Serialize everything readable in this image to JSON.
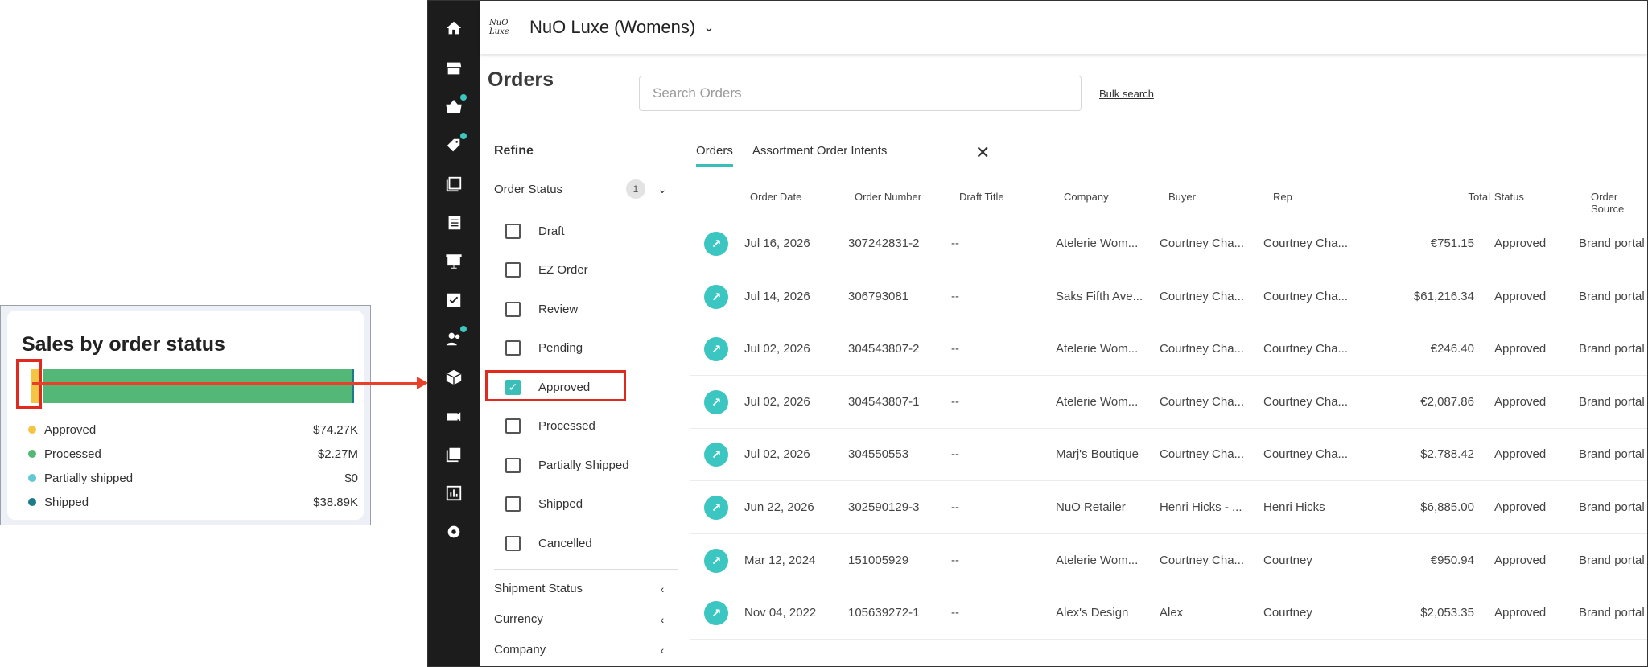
{
  "card": {
    "title": "Sales by order status",
    "legend": [
      {
        "label": "Approved",
        "value": "$74.27K",
        "color": "#f4c542"
      },
      {
        "label": "Processed",
        "value": "$2.27M",
        "color": "#52b777"
      },
      {
        "label": "Partially shipped",
        "value": "$0",
        "color": "#63c7d6"
      },
      {
        "label": "Shipped",
        "value": "$38.89K",
        "color": "#1b7a8c"
      }
    ]
  },
  "chart_data": {
    "type": "bar",
    "title": "Sales by order status",
    "categories": [
      "Approved",
      "Processed",
      "Partially shipped",
      "Shipped"
    ],
    "values": [
      74270,
      2270000,
      0,
      38890
    ],
    "orientation": "horizontal-stacked"
  },
  "header": {
    "brand_logo": "NuO Luxe",
    "brand_name": "NuO Luxe (Womens)"
  },
  "page": {
    "title": "Orders",
    "search_placeholder": "Search Orders",
    "bulk_search": "Bulk search"
  },
  "refine": {
    "title": "Refine",
    "order_status": {
      "label": "Order Status",
      "count": "1",
      "options": [
        {
          "label": "Draft",
          "checked": false
        },
        {
          "label": "EZ Order",
          "checked": false
        },
        {
          "label": "Review",
          "checked": false
        },
        {
          "label": "Pending",
          "checked": false
        },
        {
          "label": "Approved",
          "checked": true
        },
        {
          "label": "Processed",
          "checked": false
        },
        {
          "label": "Partially Shipped",
          "checked": false
        },
        {
          "label": "Shipped",
          "checked": false
        },
        {
          "label": "Cancelled",
          "checked": false
        }
      ]
    },
    "facets": [
      "Shipment Status",
      "Currency",
      "Company"
    ]
  },
  "tabs": [
    "Orders",
    "Assortment Order Intents"
  ],
  "table": {
    "columns": [
      "Order Date",
      "Order Number",
      "Draft Title",
      "Company",
      "Buyer",
      "Rep",
      "Total",
      "Status",
      "Order Source"
    ],
    "rows": [
      [
        "Jul 16, 2026",
        "307242831-2",
        "--",
        "Atelerie Wom...",
        "Courtney Cha...",
        "Courtney Cha...",
        "€751.15",
        "Approved",
        "Brand portal"
      ],
      [
        "Jul 14, 2026",
        "306793081",
        "--",
        "Saks Fifth Ave...",
        "Courtney Cha...",
        "Courtney Cha...",
        "$61,216.34",
        "Approved",
        "Brand portal"
      ],
      [
        "Jul 02, 2026",
        "304543807-2",
        "--",
        "Atelerie Wom...",
        "Courtney Cha...",
        "Courtney Cha...",
        "€246.40",
        "Approved",
        "Brand portal"
      ],
      [
        "Jul 02, 2026",
        "304543807-1",
        "--",
        "Atelerie Wom...",
        "Courtney Cha...",
        "Courtney Cha...",
        "€2,087.86",
        "Approved",
        "Brand portal"
      ],
      [
        "Jul 02, 2026",
        "304550553",
        "--",
        "Marj's Boutique",
        "Courtney Cha...",
        "Courtney Cha...",
        "$2,788.42",
        "Approved",
        "Brand portal"
      ],
      [
        "Jun 22, 2026",
        "302590129-3",
        "--",
        "NuO Retailer",
        "Henri Hicks - ...",
        "Henri Hicks",
        "$6,885.00",
        "Approved",
        "Brand portal"
      ],
      [
        "Mar 12, 2024",
        "151005929",
        "--",
        "Atelerie Wom...",
        "Courtney Cha...",
        "Courtney",
        "€950.94",
        "Approved",
        "Brand portal"
      ],
      [
        "Nov 04, 2022",
        "105639272-1",
        "--",
        "Alex's Design",
        "Alex",
        "Courtney",
        "$2,053.35",
        "Approved",
        "Brand portal"
      ]
    ]
  },
  "accent_color": "#3bbdb8"
}
